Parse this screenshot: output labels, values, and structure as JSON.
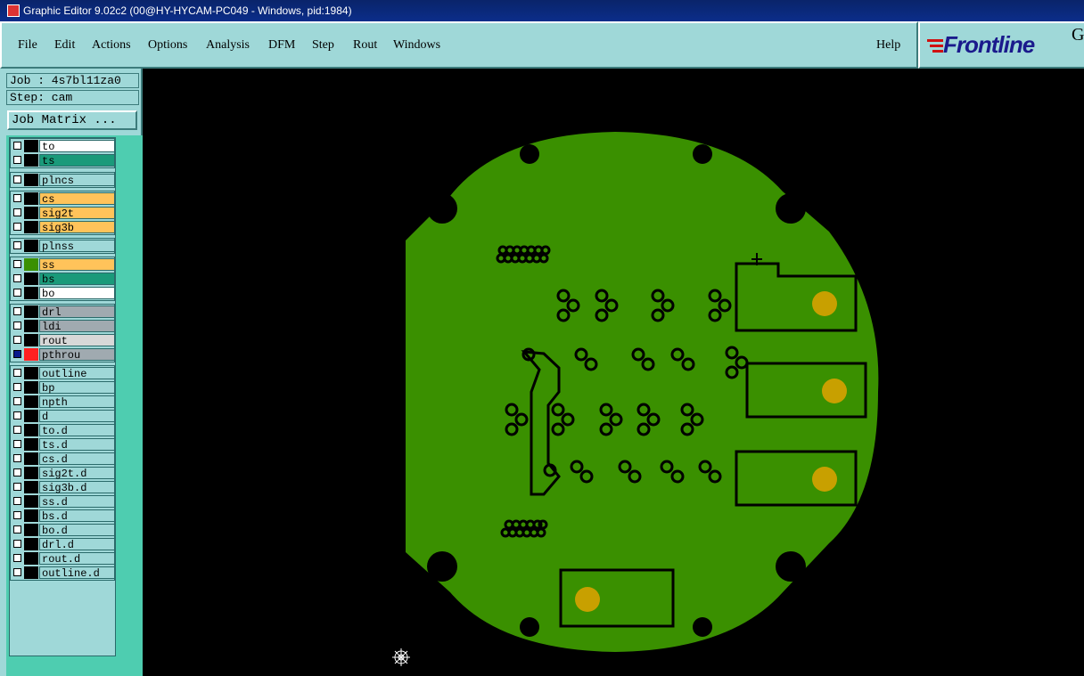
{
  "window": {
    "title": "Graphic Editor 9.02c2 (00@HY-HYCAM-PC049 - Windows, pid:1984)"
  },
  "menu": {
    "items": [
      "File",
      "Edit",
      "Actions",
      "Options",
      "Analysis",
      "DFM",
      "Step",
      "Rout",
      "Windows"
    ],
    "help": "Help"
  },
  "brand": {
    "logo": "Frontline",
    "logo_suffix": "G"
  },
  "job": {
    "label": "Job : 4s7bl11za0",
    "step": "Step: cam",
    "matrix_button": "Job Matrix ..."
  },
  "layers": [
    {
      "name": "to",
      "color": "#ffffff"
    },
    {
      "name": "ts",
      "color": "#1a9a7a"
    },
    {
      "name": "plncs",
      "color": "#9fd8d8"
    },
    {
      "name": "cs",
      "color": "#ffc35a"
    },
    {
      "name": "sig2t",
      "color": "#ffc35a"
    },
    {
      "name": "sig3b",
      "color": "#ffc35a"
    },
    {
      "name": "plnss",
      "color": "#9fd8d8"
    },
    {
      "name": "ss",
      "color": "#ffc35a"
    },
    {
      "name": "bs",
      "color": "#1a9a7a"
    },
    {
      "name": "bo",
      "color": "#ffffff"
    },
    {
      "name": "drl",
      "color": "#a0aab0"
    },
    {
      "name": "ldi",
      "color": "#a0aab0"
    },
    {
      "name": "rout",
      "color": "#d8d8d8"
    },
    {
      "name": "pthrou",
      "color": "#a0aab0"
    },
    {
      "name": "outline",
      "color": "#9fd8d8"
    },
    {
      "name": "bp",
      "color": "#9fd8d8"
    },
    {
      "name": "npth",
      "color": "#9fd8d8"
    },
    {
      "name": "d",
      "color": "#9fd8d8"
    },
    {
      "name": "to.d",
      "color": "#9fd8d8"
    },
    {
      "name": "ts.d",
      "color": "#9fd8d8"
    },
    {
      "name": "cs.d",
      "color": "#9fd8d8"
    },
    {
      "name": "sig2t.d",
      "color": "#9fd8d8"
    },
    {
      "name": "sig3b.d",
      "color": "#9fd8d8"
    },
    {
      "name": "ss.d",
      "color": "#9fd8d8"
    },
    {
      "name": "bs.d",
      "color": "#9fd8d8"
    },
    {
      "name": "bo.d",
      "color": "#9fd8d8"
    },
    {
      "name": "drl.d",
      "color": "#9fd8d8"
    },
    {
      "name": "rout.d",
      "color": "#9fd8d8"
    },
    {
      "name": "outline.d",
      "color": "#9fd8d8"
    }
  ],
  "active_layer": {
    "name": "pthrou",
    "swatch_color": "#ff2020",
    "checkbox_color": "#0a1a8c"
  },
  "colors": {
    "board": "#3a9000",
    "pad": "#c8a000",
    "ui_bg": "#9fd8d8",
    "panel": "#4ecdb0"
  }
}
